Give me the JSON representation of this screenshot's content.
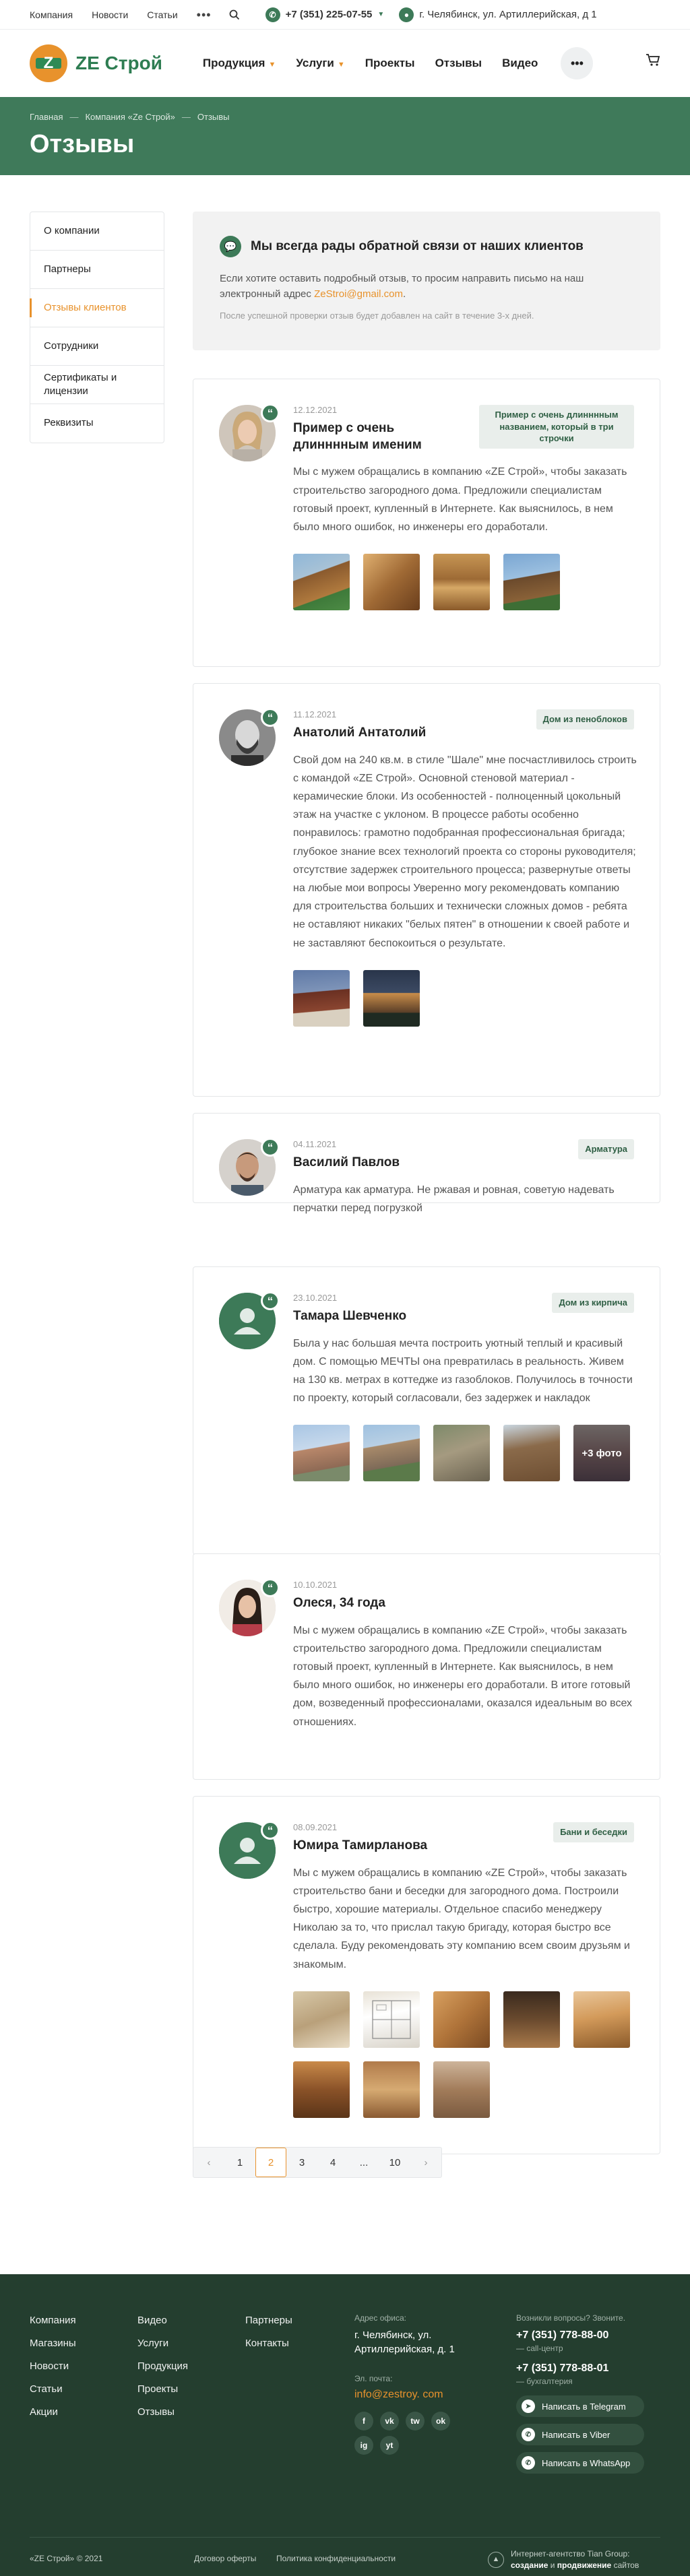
{
  "topbar": {
    "links": [
      "Компания",
      "Новости",
      "Статьи"
    ],
    "more": "•••",
    "phone": "+7 (351) 225-07-55",
    "address": "г. Челябинск, ул. Артиллерийская, д 1"
  },
  "header": {
    "logo_text": "ZE Строй",
    "logo_mark": "Z",
    "nav": [
      {
        "label": "Продукция",
        "dropdown": true
      },
      {
        "label": "Услуги",
        "dropdown": true
      },
      {
        "label": "Проекты",
        "dropdown": false
      },
      {
        "label": "Отзывы",
        "dropdown": false
      },
      {
        "label": "Видео",
        "dropdown": false
      }
    ],
    "more": "•••"
  },
  "banner": {
    "breadcrumbs": [
      "Главная",
      "Компания «Ze Строй»",
      "Отзывы"
    ],
    "title": "Отзывы"
  },
  "sidebar": {
    "items": [
      {
        "label": "О компании",
        "active": false
      },
      {
        "label": "Партнеры",
        "active": false
      },
      {
        "label": "Отзывы клиентов",
        "active": true
      },
      {
        "label": "Сотрудники",
        "active": false
      },
      {
        "label": "Сертификаты и лицензии",
        "active": false
      },
      {
        "label": "Реквизиты",
        "active": false
      }
    ]
  },
  "notice": {
    "title": "Мы всегда рады обратной связи от наших клиентов",
    "text": "Если хотите оставить подробный отзыв, то просим направить письмо на наш электронный адрес",
    "email": "ZeStroi@gmail.com",
    "note": "После успешной проверки отзыв будет добавлен на сайт в течение 3-х дней."
  },
  "reviews": [
    {
      "date": "12.12.2021",
      "name": "Пример с очень длинннным именим",
      "tag": "Пример с очень длинннным названием, который в три строчки",
      "text": "Мы с мужем обращались в компанию «ZE Строй», чтобы заказать строительство загородного дома. Предложили специалистам готовый проект, купленный в Интернете. Как выяснилось, в нем было много ошибок, но инженеры его доработали.",
      "photos_more": ""
    },
    {
      "date": "11.12.2021",
      "name": "Анатолий Антатолий",
      "tag": "Дом из пеноблоков",
      "text": "Свой дом на 240 кв.м. в стиле \"Шале\" мне посчастливилось строить с командой «ZE Строй». Основной стеновой материал - керамические блоки. Из особенностей - полноценный цокольный этаж на участке с уклоном. В процессе работы особенно понравилось: грамотно подобранная профессиональная бригада; глубокое знание всех технологий проекта со стороны руководителя; отсутствие задержек строительного процесса; развернутые ответы на любые мои вопросы Уверенно могу рекомендовать компанию для строительства больших и технически сложных домов - ребята не оставляют никаких \"белых пятен\" в отношении к своей работе и не заставляют беспокоиться о результате.",
      "photos_more": ""
    },
    {
      "date": "04.11.2021",
      "name": "Василий Павлов",
      "tag": "Арматура",
      "text": "Арматура как арматура. Не ржавая и ровная, советую надевать перчатки перед погрузкой",
      "photos_more": ""
    },
    {
      "date": "23.10.2021",
      "name": "Тамара Шевченко",
      "tag": "Дом из кирпича",
      "text": "Была у нас большая мечта построить уютный теплый и красивый дом. С помощью МЕЧТЫ она превратилась в реальность. Живем на 130 кв. метрах в коттедже из газоблоков. Получилось в точности по проекту, который согласовали, без задержек и накладок",
      "photos_more": "+3 фото"
    },
    {
      "date": "10.10.2021",
      "name": "Олеся, 34 года",
      "tag": "",
      "text": "Мы с мужем обращались в компанию «ZE Строй», чтобы заказать строительство загородного дома. Предложили специалистам готовый проект, купленный в Интернете. Как выяснилось, в нем было много ошибок, но инженеры его доработали. В итоге готовый дом, возведенный профессионалами, оказался идеальным во всех отношениях.",
      "photos_more": ""
    },
    {
      "date": "08.09.2021",
      "name": "Юмира Тамирланова",
      "tag": "Бани и беседки",
      "text": "Мы с мужем обращались в компанию «ZE Строй», чтобы заказать строительство бани и беседки для загородного дома. Построили быстро, хорошие материалы. Отдельное спасибо менеджеру Николаю за то, что прислал такую бригаду, которая быстро все сделала. Буду рекомендовать эту компанию всем своим друзьям и знакомым.",
      "photos_more": ""
    }
  ],
  "pagination": {
    "prev": "‹",
    "pages": [
      "1",
      "2",
      "3",
      "4",
      "...",
      "10"
    ],
    "current": "2",
    "next": "›"
  },
  "footer": {
    "col1": [
      "Компания",
      "Магазины",
      "Новости",
      "Статьи",
      "Акции"
    ],
    "col2": [
      "Видео",
      "Услуги",
      "Продукция",
      "Проекты",
      "Отзывы"
    ],
    "col3": [
      "Партнеры",
      "Контакты"
    ],
    "address_label": "Адрес офиса:",
    "address": "г. Челябинск, ул. Артиллерийская, д. 1",
    "email_label": "Эл. почта:",
    "email": "info@zestroy. com",
    "social": [
      "f",
      "vk",
      "tw",
      "ok",
      "ig",
      "yt"
    ],
    "questions_label": "Возникли вопросы? Звоните.",
    "phone1": "+7 (351) 778-88-00",
    "phone1_sub": "— call-центр",
    "phone2": "+7 (351) 778-88-01",
    "phone2_sub": "— бухгалтерия",
    "messengers": [
      "Написать в Telegram",
      "Написать в Viber",
      "Написать в WhatsApp"
    ],
    "copyright": "«ZE Строй» © 2021",
    "offer": "Договор оферты",
    "privacy": "Политика конфиденциальности",
    "agency_line1": "Интернет-агентство Tian Group:",
    "agency_line2_a": "создание",
    "agency_line2_b": " и ",
    "agency_line2_c": "продвижение",
    "agency_line2_d": " сайтов"
  },
  "colors": {
    "brand_green": "#3f7a5a",
    "accent_orange": "#e8922c",
    "footer_bg": "#243e2f"
  }
}
